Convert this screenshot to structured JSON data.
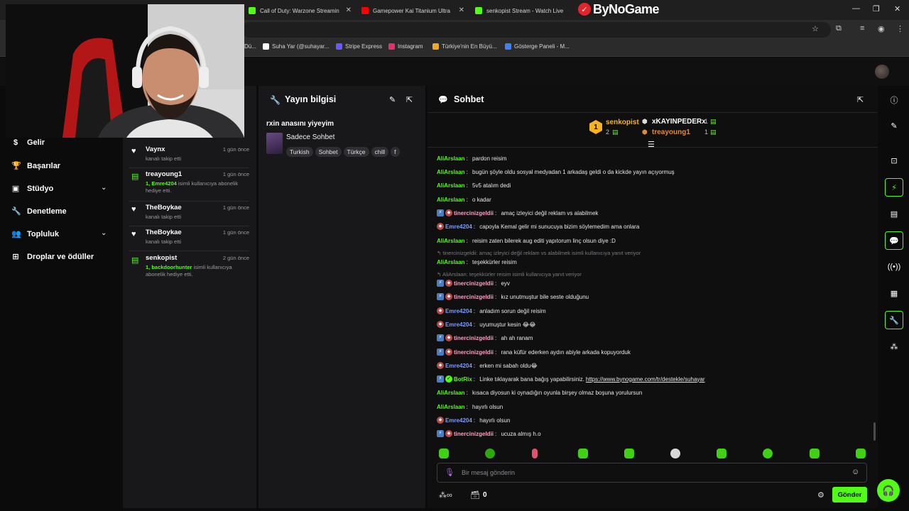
{
  "browser": {
    "tabs": [
      {
        "label": "Call of Duty: Warzone Streamin",
        "color": "#53fc18"
      },
      {
        "label": "Gamepower Kai Titanium Ultra",
        "color": "#ff0000"
      },
      {
        "label": "senkopist Stream - Watch Live",
        "color": "#53fc18"
      }
    ],
    "brand": "ByNoGame",
    "bookmarks": [
      {
        "label": "Dü...",
        "color": "#888888"
      },
      {
        "label": "Suha Yar (@suhayar...",
        "color": "#ffffff"
      },
      {
        "label": "Stripe Express",
        "color": "#635bff"
      },
      {
        "label": "Instagram",
        "color": "#e1306c"
      },
      {
        "label": "Türkiye'nin En Büyü...",
        "color": "#f5a623"
      },
      {
        "label": "Gösterge Paneli - M...",
        "color": "#3b82f6"
      }
    ]
  },
  "nav": {
    "items": [
      {
        "label": "Gelir",
        "icon": "dollar-icon"
      },
      {
        "label": "Başarılar",
        "icon": "trophy-icon"
      },
      {
        "label": "Stüdyo",
        "icon": "studio-icon"
      },
      {
        "label": "Denetleme",
        "icon": "wrench-icon"
      },
      {
        "label": "Topluluk",
        "icon": "people-icon"
      },
      {
        "label": "Droplar ve ödüller",
        "icon": "gift-icon"
      }
    ]
  },
  "activity": {
    "items": [
      {
        "name": "Vaynx",
        "time": "1 gün önce",
        "desc": "kanalı takip etti",
        "type": "follow"
      },
      {
        "name": "treayoung1",
        "time": "1 gün önce",
        "highlight": "1, Emre4204",
        "desc": " isimli kullanıcıya abonelik hediye etti.",
        "type": "gift"
      },
      {
        "name": "TheBoykae",
        "time": "1 gün önce",
        "desc": "kanalı takip etti",
        "type": "follow"
      },
      {
        "name": "TheBoykae",
        "time": "1 gün önce",
        "desc": "kanalı takip etti",
        "type": "follow"
      },
      {
        "name": "senkopist",
        "time": "2 gün önce",
        "highlight": "1, backdoorhunter",
        "desc": " isimli kullanıcıya abonelik hediye etti.",
        "type": "gift"
      }
    ]
  },
  "streaminfo": {
    "title": "Yayın bilgisi",
    "stream_title": "rxin anasını yiyeyim",
    "category": "Sadece Sohbet",
    "tags": [
      "Turkish",
      "Sohbet",
      "Türkçe",
      "chill",
      "f"
    ]
  },
  "chat": {
    "title": "Sohbet",
    "leaderboard": {
      "first": {
        "rank": "1",
        "name": "senkopist",
        "count": "2"
      },
      "second": {
        "name": "xKAYINPEDERx",
        "count": "1"
      },
      "third": {
        "name": "treayoung1",
        "count": "1"
      }
    },
    "messages": [
      {
        "user": "AliArslaan",
        "color": "#53fc18",
        "text": "pardon reisim",
        "badges": []
      },
      {
        "user": "AliArslaan",
        "color": "#53fc18",
        "text": "bugün şöyle oldu sosyal medyadan 1 arkadaş geldi o da kickde yayın açıyormuş",
        "badges": []
      },
      {
        "user": "AliArslaan",
        "color": "#53fc18",
        "text": "5v5 atalım dedi",
        "badges": []
      },
      {
        "user": "AliArslaan",
        "color": "#53fc18",
        "text": "o kadar",
        "badges": []
      },
      {
        "user": "tinercinizgeldii",
        "color": "#ff9ec4",
        "text": "amaç izleyici değil reklam vs alabilmek",
        "badges": [
          "k",
          "s"
        ]
      },
      {
        "user": "Emre4204",
        "color": "#7b9cff",
        "text": "capoyla Kemal gelir mi sunucuya bizim söylemedim ama onlara",
        "badges": [
          "s"
        ]
      },
      {
        "user": "AliArslaan",
        "color": "#53fc18",
        "text": "reisim zaten bilerek aug editi yapıtorum linç olsun diye :D",
        "badges": []
      },
      {
        "reply": "tinercinizgeldii: amaç izleyici değil reklam vs alabilmek isimli kullanıcıya yanıt veriyor"
      },
      {
        "user": "AliArslaan",
        "color": "#53fc18",
        "text": "teşekkürler reisim",
        "badges": []
      },
      {
        "reply": "AliArslaan: teşekkürler reisim isimli kullanıcıya yanıt veriyor"
      },
      {
        "user": "tinercinizgeldii",
        "color": "#ff9ec4",
        "text": "eyv",
        "badges": [
          "k",
          "s"
        ]
      },
      {
        "user": "tinercinizgeldii",
        "color": "#ff9ec4",
        "text": "kız unutmuştur bile seste olduğunu",
        "badges": [
          "k",
          "s"
        ]
      },
      {
        "user": "Emre4204",
        "color": "#7b9cff",
        "text": "anladım sorun değil reisim",
        "badges": [
          "s"
        ]
      },
      {
        "user": "Emre4204",
        "color": "#7b9cff",
        "text": "uyumuştur kesin 😂😂",
        "badges": [
          "s"
        ]
      },
      {
        "user": "tinercinizgeldii",
        "color": "#ff9ec4",
        "text": "ah ah ranam",
        "badges": [
          "k",
          "s"
        ]
      },
      {
        "user": "tinercinizgeldii",
        "color": "#ff9ec4",
        "text": "rana küfür ederken aydın abiyle arkada kopuyorduk",
        "badges": [
          "k",
          "s"
        ]
      },
      {
        "user": "Emre4204",
        "color": "#7b9cff",
        "text": "erken mi sabah oldu😂",
        "badges": [
          "s"
        ]
      },
      {
        "user": "BotRix",
        "color": "#53fc18",
        "text": "Linke tıklayarak bana bağış yapabilirsiniz. ",
        "link": "https://www.bynogame.com/tr/destekle/suhayar",
        "badges": [
          "k",
          "v"
        ]
      },
      {
        "user": "AliArslaan",
        "color": "#53fc18",
        "text": "kısaca diyosun ki oynadığın oyunla birşey olmaz boşuna yorulursun",
        "badges": []
      },
      {
        "user": "AliArslaan",
        "color": "#53fc18",
        "text": "hayırlı olsun",
        "badges": []
      },
      {
        "user": "Emre4204",
        "color": "#7b9cff",
        "text": "hayırlı olsun",
        "badges": [
          "s"
        ]
      },
      {
        "user": "tinercinizgeldii",
        "color": "#ff9ec4",
        "text": "ucuza almış h.o",
        "badges": [
          "k",
          "s"
        ]
      }
    ],
    "input_placeholder": "Bir mesaj gönderin",
    "points": "0",
    "send_label": "Gönder"
  },
  "colors": {
    "accent": "#53fc18",
    "panel": "#18181a",
    "bg": "#0b0b0c"
  }
}
